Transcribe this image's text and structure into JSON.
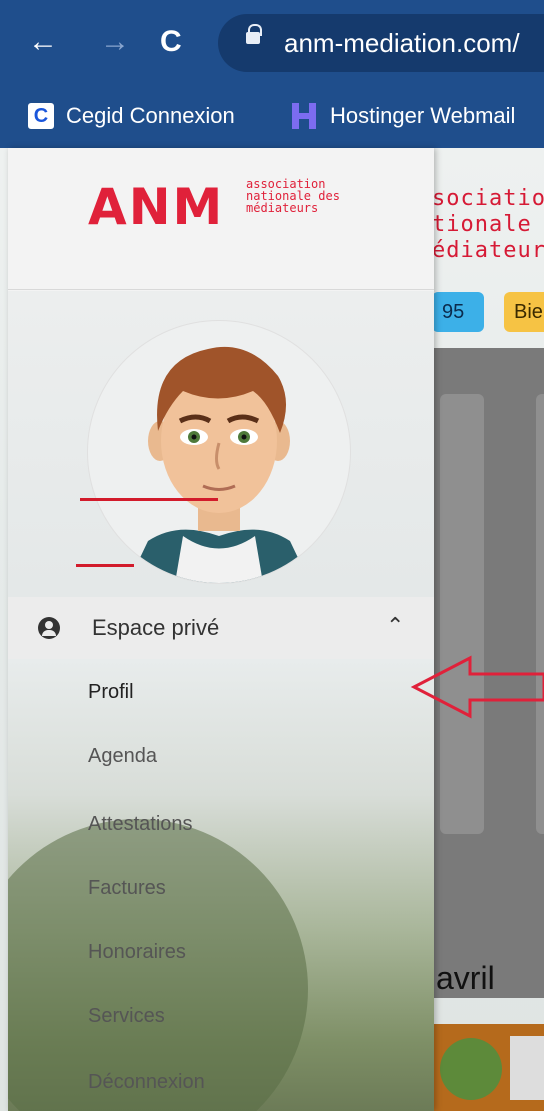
{
  "browser": {
    "url": "anm-mediation.com/",
    "bookmarks": [
      {
        "label": "Cegid Connexion",
        "icon": "cegid-c-icon"
      },
      {
        "label": "Hostinger Webmail",
        "icon": "hostinger-h-icon"
      }
    ]
  },
  "page": {
    "title_lines": [
      "sociatio",
      "tionale ",
      "édiateur"
    ],
    "badge_number": "95",
    "badge_text": "Bie",
    "month_text": "avril"
  },
  "drawer": {
    "logo": "ANM",
    "logo_sub_lines": [
      "association",
      "nationale des",
      "médiateurs"
    ],
    "section_label": "Espace privé",
    "items": [
      {
        "label": "Profil"
      },
      {
        "label": "Agenda"
      },
      {
        "label": "Attestations"
      },
      {
        "label": "Factures"
      },
      {
        "label": "Honoraires"
      },
      {
        "label": "Services"
      },
      {
        "label": "Déconnexion"
      }
    ]
  },
  "colors": {
    "browser_bar": "#1f4e8c",
    "brand_red": "#e0213a",
    "underline_red": "#d21b2b",
    "badge_blue": "#3cb0e8",
    "badge_yellow": "#f6c344"
  }
}
